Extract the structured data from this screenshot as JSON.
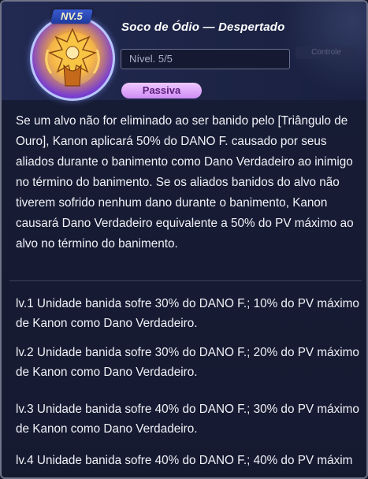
{
  "skill": {
    "level_tag": "NV.5",
    "title": "Soco de Ódio — Despertado",
    "level_value": "Nível. 5/5",
    "side_label": "Controle",
    "type_badge": "Passiva",
    "portrait_icon": "golden-saint-portrait-icon"
  },
  "description": "Se um alvo não for eliminado ao ser banido pelo [Triângulo de Ouro], Kanon aplicará 50% do DANO F. causado por seus aliados durante o banimento como Dano Verdadeiro ao inimigo no término do banimento. Se os aliados banidos do alvo não tiverem sofrido nenhum dano durante o banimento, Kanon causará Dano Verdadeiro equivalente a 50% do PV máximo ao alvo no término do banimento.",
  "levels": [
    {
      "text": "lv.1 Unidade banida sofre 30% do DANO F.; 10% do PV máximo de Kanon como Dano Verdadeiro."
    },
    {
      "text": "lv.2 Unidade banida sofre 30% do DANO F.; 20% do PV máximo de Kanon como Dano Verdadeiro."
    },
    {
      "text": "lv.3 Unidade banida sofre 40% do DANO F.; 30% do PV máximo de Kanon como Dano Verdadeiro."
    },
    {
      "text": "lv.4 Unidade banida sofre 40% do DANO F.; 40% do PV máxim"
    }
  ],
  "colors": {
    "badge_bg": "#cf8cf5",
    "level_tag_bg": "#1e3a9c",
    "panel_bg": "#171c35"
  }
}
